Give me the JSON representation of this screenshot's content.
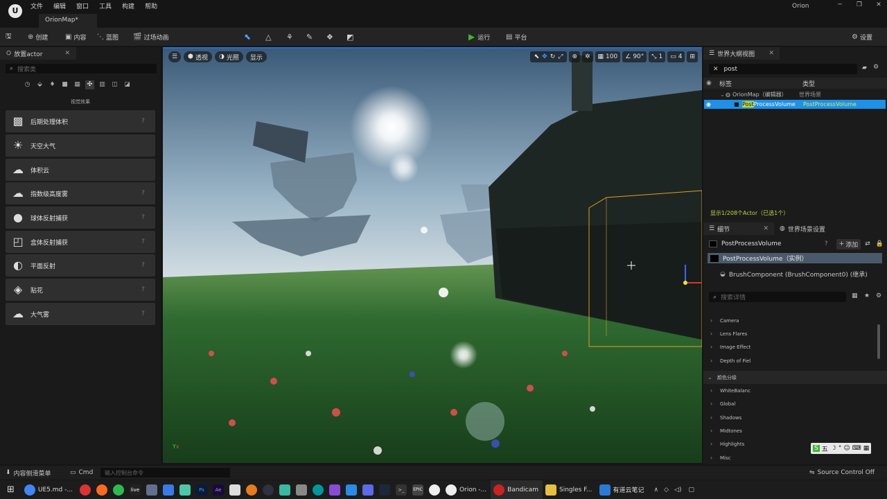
{
  "menu": [
    "文件",
    "编辑",
    "窗口",
    "工具",
    "构建",
    "帮助"
  ],
  "map_tab": "OrionMap*",
  "project_name": "Orion",
  "toolbar": {
    "create": "创建",
    "content": "内容",
    "blueprint": "蓝图",
    "cinematics": "过场动画",
    "run": "运行",
    "platform": "平台",
    "settings": "设置"
  },
  "place_actors": {
    "tab": "放置actor",
    "search_placeholder": "搜索类",
    "category": "视觉效果",
    "items": [
      {
        "label": "后期处理体积",
        "icon": "post-process-icon"
      },
      {
        "label": "天空大气",
        "icon": "sky-atmosphere-icon"
      },
      {
        "label": "体积云",
        "icon": "volumetric-cloud-icon"
      },
      {
        "label": "指数级高度雾",
        "icon": "height-fog-icon"
      },
      {
        "label": "球体反射捕获",
        "icon": "sphere-reflection-icon"
      },
      {
        "label": "盒体反射捕获",
        "icon": "box-reflection-icon"
      },
      {
        "label": "平面反射",
        "icon": "planar-reflection-icon"
      },
      {
        "label": "贴花",
        "icon": "decal-icon"
      },
      {
        "label": "大气雾",
        "icon": "atmospheric-fog-icon"
      }
    ]
  },
  "viewport": {
    "perspective": "透视",
    "lit": "光照",
    "show": "显示",
    "grid_snap": "100",
    "rot_snap": "90°",
    "scale_snap": "1",
    "cam_speed": "4"
  },
  "outliner": {
    "tab": "世界大纲视图",
    "search_value": "post",
    "col_label": "标签",
    "col_type": "类型",
    "rows": [
      {
        "label": "OrionMap（编辑器）",
        "type": "世界场景"
      },
      {
        "label": "PostProcessVolume",
        "type": "PostProcessVolume",
        "label_highlight": "Post",
        "label_rest": "ProcessVolume",
        "type_highlight": "Post",
        "type_rest": "ProcessVolume"
      }
    ],
    "status": "显示1/208个Actor（已选1个）"
  },
  "details": {
    "tab": "细节",
    "world_settings_tab": "世界场景设置",
    "object_name": "PostProcessVolume",
    "add_button": "添加",
    "components": [
      "PostProcessVolume（实例）",
      "BrushComponent (BrushComponent0) (继承)"
    ],
    "search_placeholder": "搜索详情",
    "sections": [
      "Camera",
      "Lens Flares",
      "Image Effect",
      "Depth of Fiel"
    ],
    "group_title": "颜色分级",
    "group_items": [
      "WhiteBalanc",
      "Global",
      "Shadows",
      "Midtones",
      "Highlights",
      "Misc"
    ]
  },
  "statusbar": {
    "content_drawer": "内容侧滑菜单",
    "cmd": "Cmd",
    "console_placeholder": "输入控制台命令",
    "source_control": "Source Control Off"
  },
  "ime": "五",
  "taskbar": {
    "items": [
      {
        "label": "UE5.md -...",
        "color": "#4285f4"
      },
      {
        "label": "Orion -...",
        "color": "#333333"
      },
      {
        "label": "Bandicam",
        "color": "#cc2222"
      },
      {
        "label": "Singles F...",
        "color": "#e8c040"
      },
      {
        "label": "有道云笔记",
        "color": "#2a7ad5"
      }
    ],
    "icons": [
      "netease-music-icon",
      "firefox-icon",
      "wechat-icon",
      "live-icon",
      "camera-icon",
      "mail-icon",
      "houdini-icon",
      "photoshop-icon",
      "after-effects-icon",
      "inkscape-icon",
      "blender-icon",
      "obs-icon",
      "git-icon",
      "davinci-icon",
      "arduino-icon",
      "visual-studio-icon",
      "vscode-icon",
      "code-icon",
      "steam-icon",
      "terminal-icon",
      "epic-icon",
      "unreal-icon"
    ]
  },
  "colors": {
    "accent": "#2c6bc9",
    "selection": "#1e90e8",
    "highlight": "#b8d842",
    "run": "#3cb832"
  }
}
